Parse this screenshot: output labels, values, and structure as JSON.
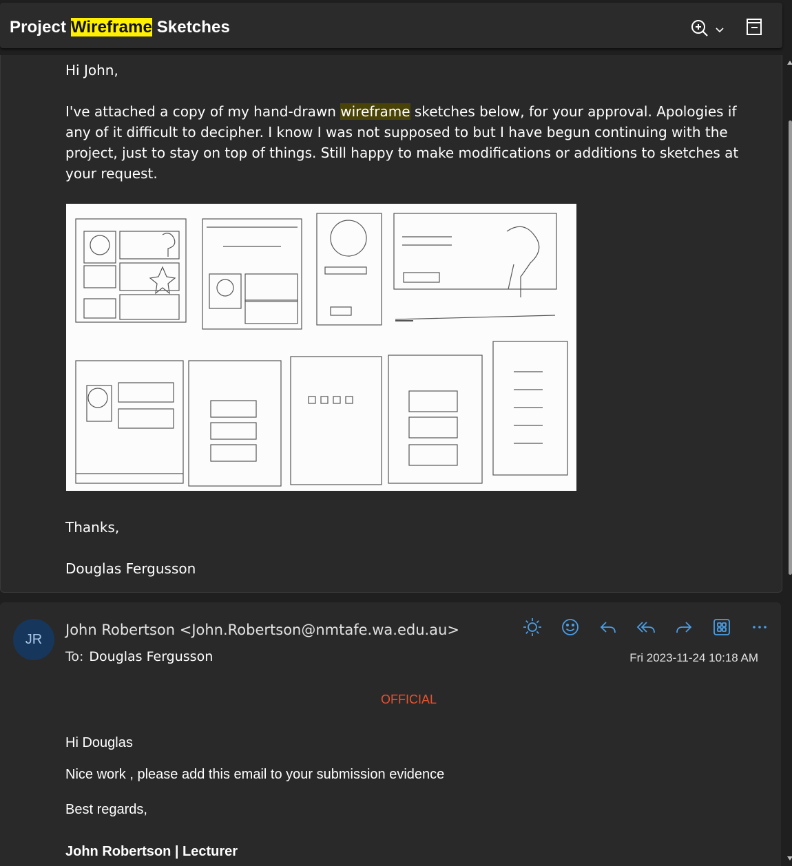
{
  "subject": {
    "before": "Project ",
    "highlight": "Wireframe",
    "after": " Sketches"
  },
  "toolbar": {
    "zoom_icon": "zoom-in-icon",
    "chevron_icon": "chevron-down-icon",
    "reading_icon": "reading-pane-icon"
  },
  "message1": {
    "greeting": "Hi John,",
    "para_before": "I've attached a copy of my hand-drawn ",
    "para_highlight": "wireframe",
    "para_line1_rest": " sketches below, for your approval. Apologies if",
    "para_line2": "any of it difficult to decipher. I know I was not supposed to but I have begun continuing with the",
    "para_line3": "project, just to stay on top of things. Still happy to make modifications or additions to sketches at",
    "para_line4": "your request.",
    "attachment_icon": "wireframe-sketch-image",
    "signoff": "Thanks,",
    "signature": "Douglas Fergusson"
  },
  "message2": {
    "avatar_initials": "JR",
    "from": "John Robertson <John.Robertson@nmtafe.wa.edu.au>",
    "to_label": "To:",
    "to_name": "Douglas Fergusson",
    "date": "Fri 2023-11-24 10:18 AM",
    "actions": [
      "sun-icon",
      "emoji-icon",
      "reply-icon",
      "reply-all-icon",
      "forward-icon",
      "apps-icon",
      "more-icon"
    ],
    "classification": "OFFICIAL",
    "greeting": "Hi Douglas",
    "body": "Nice work , please add this email to your submission evidence",
    "closing": "Best regards,",
    "signature": "John Robertson | Lecturer"
  },
  "colors": {
    "accent": "#4a9fe8",
    "highlight_yellow": "#ffef00",
    "official_red": "#e8522f",
    "avatar_bg": "#16375b"
  }
}
